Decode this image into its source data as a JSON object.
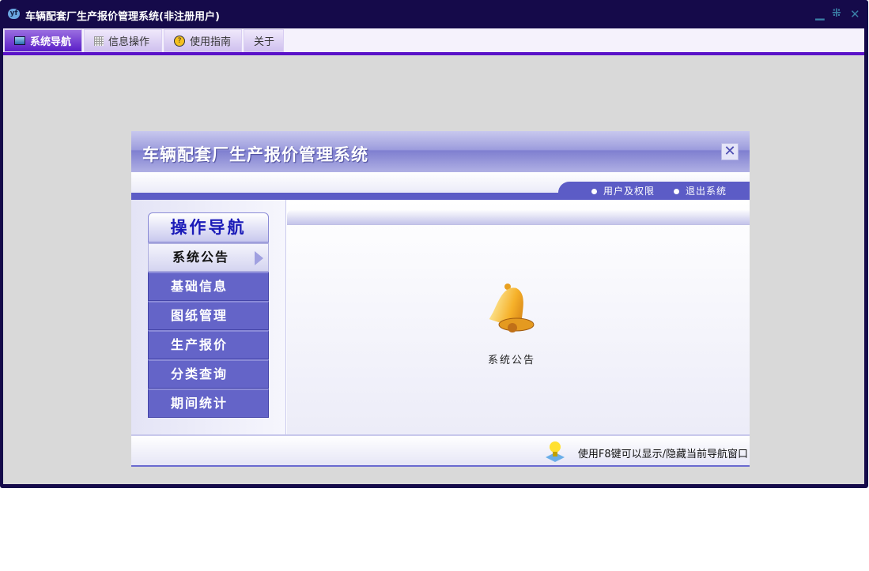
{
  "window": {
    "title": "车辆配套厂生产报价管理系统(非注册用户)",
    "logo": "yf",
    "controls": [
      "minimize-icon",
      "restore-icon",
      "close-icon"
    ]
  },
  "tabs": [
    {
      "label": "系统导航",
      "icon": "monitor-icon",
      "active": true
    },
    {
      "label": "信息操作",
      "icon": "grid-icon"
    },
    {
      "label": "使用指南",
      "icon": "help-icon"
    },
    {
      "label": "关于"
    }
  ],
  "panel": {
    "title": "车辆配套厂生产报价管理系统",
    "links": [
      "用户及权限",
      "退出系统"
    ],
    "nav": {
      "header": "操作导航",
      "items": [
        "系统公告",
        "基础信息",
        "图纸管理",
        "生产报价",
        "分类查询",
        "期间统计"
      ],
      "selected": 0
    },
    "content": {
      "label": "系统公告",
      "icon": "bell-icon"
    },
    "footer": "使用F8键可以显示/隐藏当前导航窗口"
  },
  "colors": {
    "frame": "#150a4a",
    "accent": "#5a12c8",
    "nav": "#6464c8"
  }
}
